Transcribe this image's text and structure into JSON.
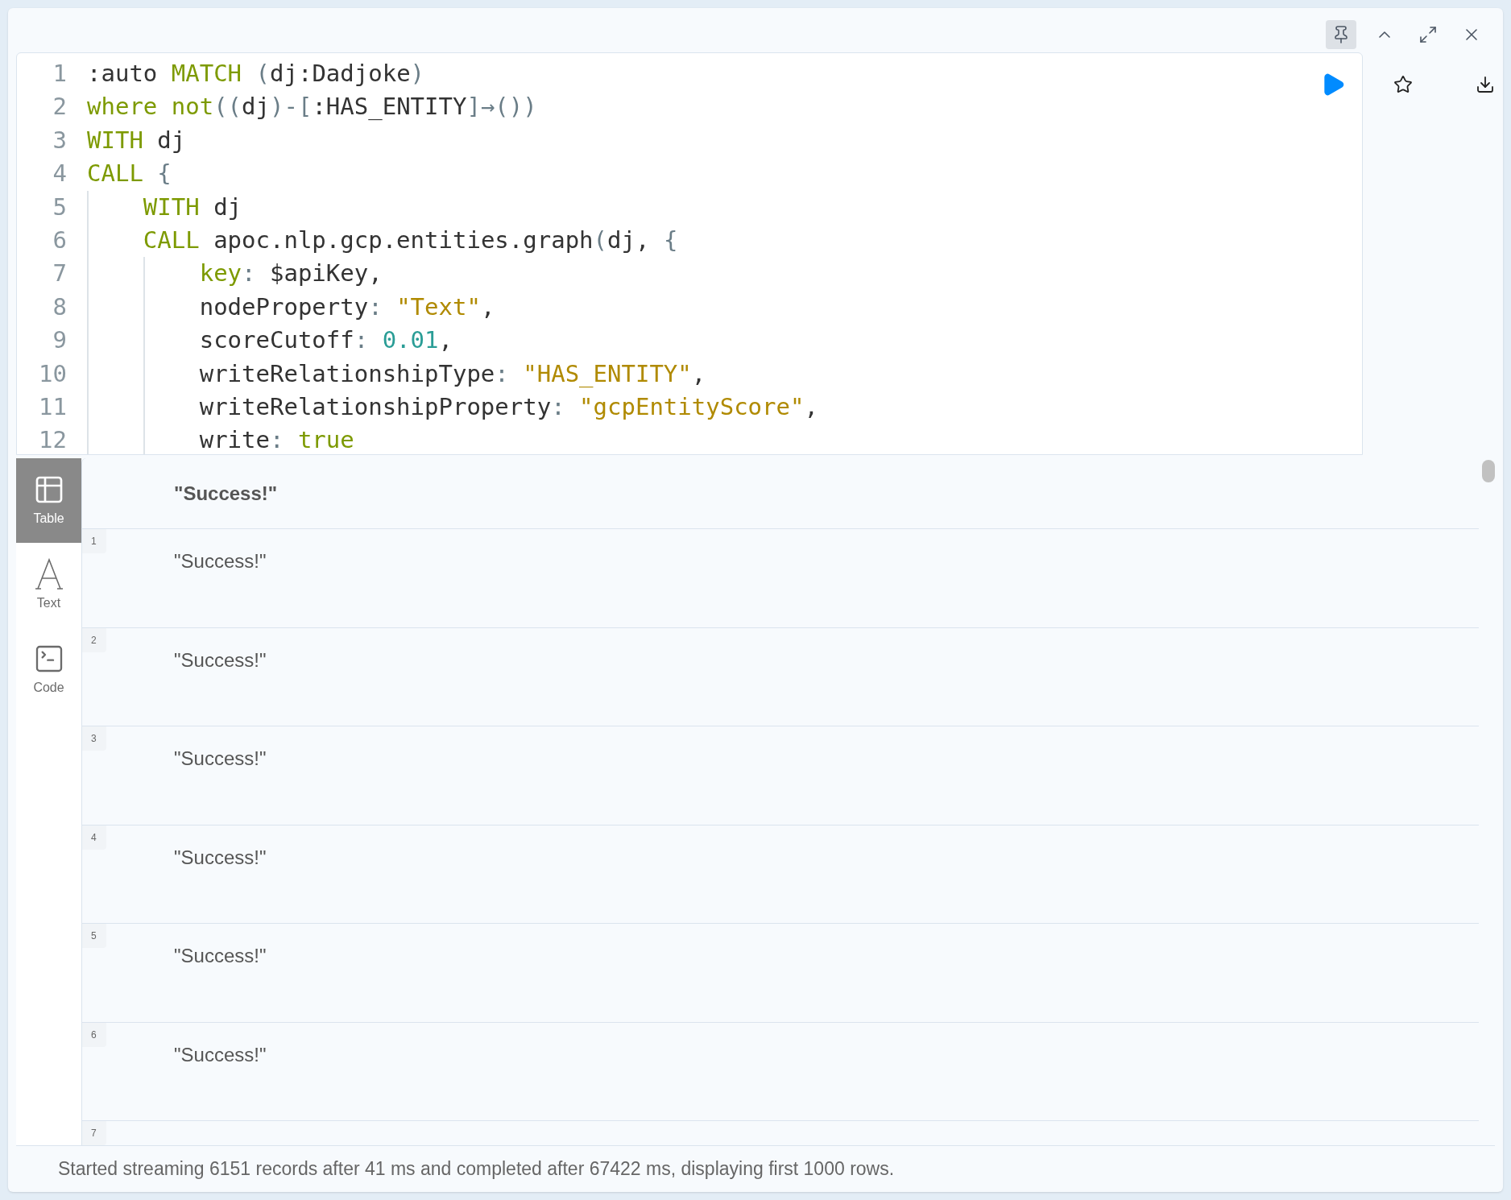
{
  "frame_actions": [
    {
      "kind": "pin",
      "selected": true
    },
    {
      "kind": "collapse",
      "selected": false
    },
    {
      "kind": "expand",
      "selected": false
    },
    {
      "kind": "close",
      "selected": false
    }
  ],
  "editor": {
    "lines": [
      {
        "number": "1",
        "tokens": [
          {
            "text": ":auto ",
            "kind": "plain"
          },
          {
            "text": "MATCH",
            "kind": "keyword"
          },
          {
            "text": " (",
            "kind": "punct"
          },
          {
            "text": "dj:Dadjoke",
            "kind": "plain"
          },
          {
            "text": ")",
            "kind": "punct"
          }
        ]
      },
      {
        "number": "2",
        "tokens": [
          {
            "text": "where not",
            "kind": "keyword"
          },
          {
            "text": "((",
            "kind": "punct"
          },
          {
            "text": "dj",
            "kind": "plain"
          },
          {
            "text": ")-[",
            "kind": "punct"
          },
          {
            "text": ":HAS_ENTITY",
            "kind": "plain"
          },
          {
            "text": "]→())",
            "kind": "punct"
          }
        ]
      },
      {
        "number": "3",
        "tokens": [
          {
            "text": "WITH",
            "kind": "keyword"
          },
          {
            "text": " dj",
            "kind": "plain"
          }
        ]
      },
      {
        "number": "4",
        "tokens": [
          {
            "text": "CALL",
            "kind": "keyword"
          },
          {
            "text": " {",
            "kind": "punct"
          }
        ]
      },
      {
        "number": "5",
        "tokens": [
          {
            "text": "    WITH",
            "kind": "keyword"
          },
          {
            "text": " dj",
            "kind": "plain"
          }
        ]
      },
      {
        "number": "6",
        "tokens": [
          {
            "text": "    CALL",
            "kind": "keyword"
          },
          {
            "text": " apoc.nlp.gcp.entities.graph",
            "kind": "plain"
          },
          {
            "text": "(",
            "kind": "punct"
          },
          {
            "text": "dj, ",
            "kind": "plain"
          },
          {
            "text": "{",
            "kind": "punct"
          }
        ]
      },
      {
        "number": "7",
        "tokens": [
          {
            "text": "        key",
            "kind": "keyword"
          },
          {
            "text": ": ",
            "kind": "punct"
          },
          {
            "text": "$apiKey,",
            "kind": "plain"
          }
        ]
      },
      {
        "number": "8",
        "tokens": [
          {
            "text": "        nodeProperty",
            "kind": "plain"
          },
          {
            "text": ": ",
            "kind": "punct"
          },
          {
            "text": "\"Text\"",
            "kind": "string"
          },
          {
            "text": ",",
            "kind": "plain"
          }
        ]
      },
      {
        "number": "9",
        "tokens": [
          {
            "text": "        scoreCutoff",
            "kind": "plain"
          },
          {
            "text": ": ",
            "kind": "punct"
          },
          {
            "text": "0.01",
            "kind": "number"
          },
          {
            "text": ",",
            "kind": "plain"
          }
        ]
      },
      {
        "number": "10",
        "tokens": [
          {
            "text": "        writeRelationshipType",
            "kind": "plain"
          },
          {
            "text": ": ",
            "kind": "punct"
          },
          {
            "text": "\"HAS_ENTITY\"",
            "kind": "string"
          },
          {
            "text": ",",
            "kind": "plain"
          }
        ]
      },
      {
        "number": "11",
        "tokens": [
          {
            "text": "        writeRelationshipProperty",
            "kind": "plain"
          },
          {
            "text": ": ",
            "kind": "punct"
          },
          {
            "text": "\"gcpEntityScore\"",
            "kind": "string"
          },
          {
            "text": ",",
            "kind": "plain"
          }
        ]
      },
      {
        "number": "12",
        "tokens": [
          {
            "text": "        write",
            "kind": "plain"
          },
          {
            "text": ": ",
            "kind": "punct"
          },
          {
            "text": "true",
            "kind": "keyword"
          }
        ]
      }
    ]
  },
  "view_tabs": [
    {
      "label": "Table",
      "kind": "table",
      "selected": true
    },
    {
      "label": "Text",
      "kind": "text",
      "selected": false
    },
    {
      "label": "Code",
      "kind": "code",
      "selected": false
    }
  ],
  "table": {
    "columns": [
      "\"Success!\""
    ],
    "rows": [
      {
        "index": "1",
        "value": "\"Success!\""
      },
      {
        "index": "2",
        "value": "\"Success!\""
      },
      {
        "index": "3",
        "value": "\"Success!\""
      },
      {
        "index": "4",
        "value": "\"Success!\""
      },
      {
        "index": "5",
        "value": "\"Success!\""
      },
      {
        "index": "6",
        "value": "\"Success!\""
      },
      {
        "index": "7"
      }
    ]
  },
  "status_bar": "Started streaming 6151 records after 41 ms and completed after 67422 ms, displaying first 1000 rows."
}
